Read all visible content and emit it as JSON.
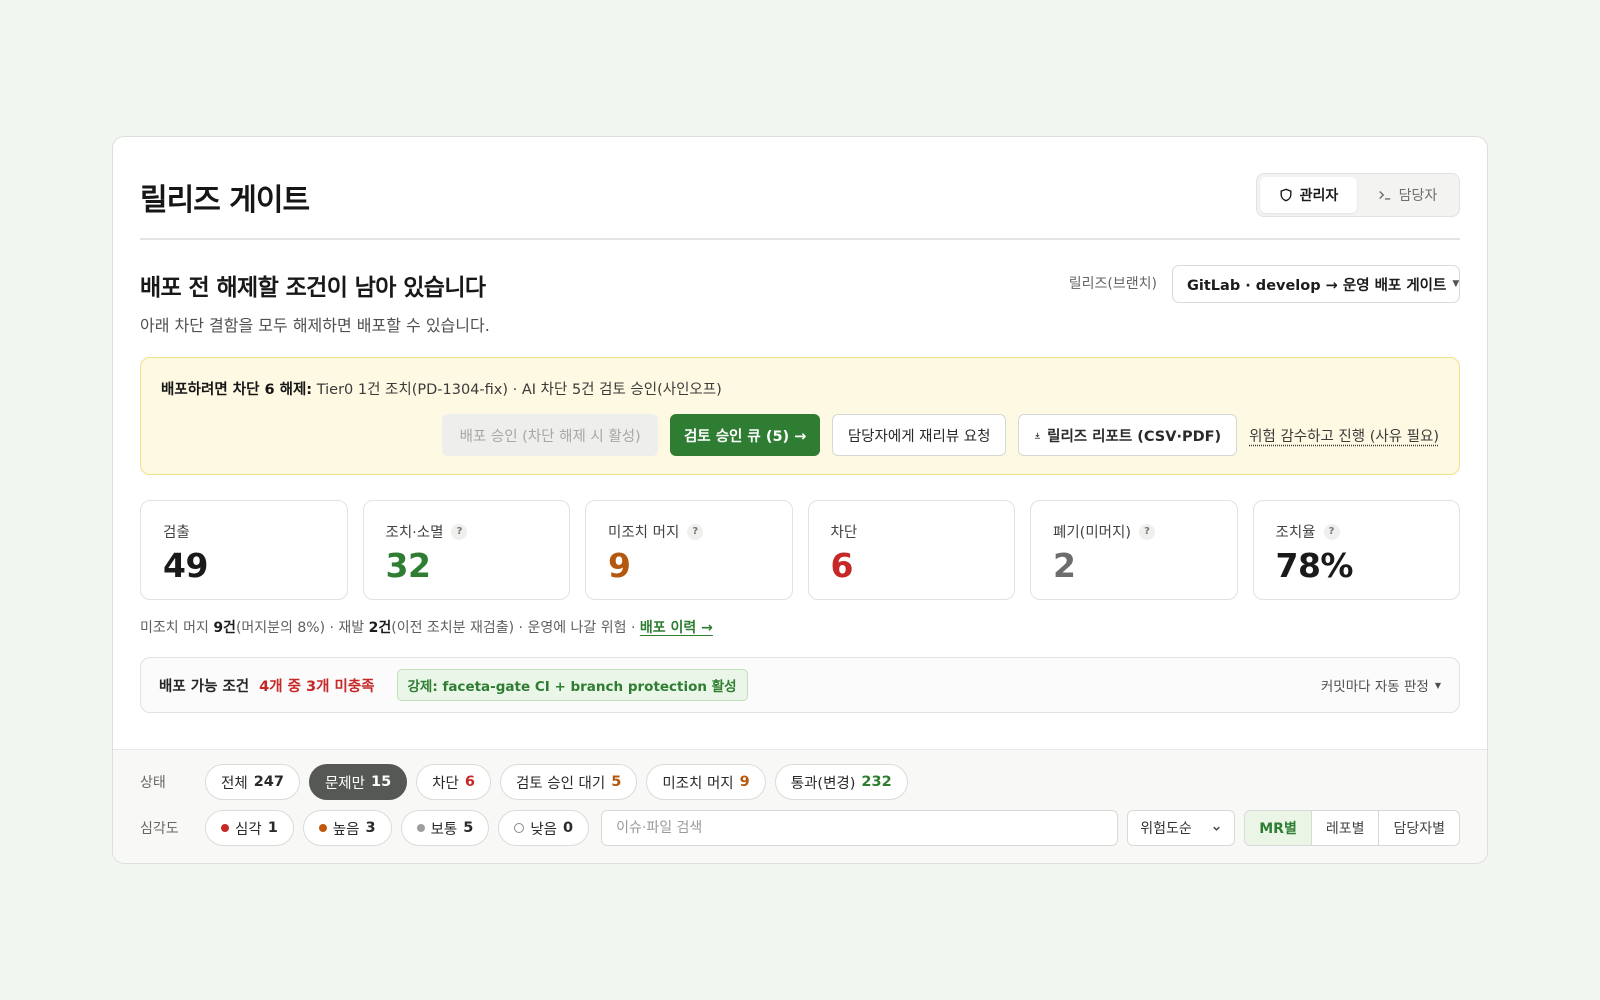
{
  "header": {
    "title": "릴리즈 게이트",
    "roles": [
      {
        "label": "관리자",
        "icon": "shield-icon",
        "active": true
      },
      {
        "label": "담당자",
        "icon": "terminal-icon",
        "active": false
      }
    ]
  },
  "summary": {
    "headline": "배포 전 해제할 조건이 남아 있습니다",
    "subline": "아래 차단 결함을 모두 해제하면 배포할 수 있습니다.",
    "release_label": "릴리즈(브랜치)",
    "release_value": "GitLab · develop → 운영 배포 게이트"
  },
  "banner": {
    "lead": "배포하려면 차단 6 해제:",
    "detail": "Tier0 1건 조치(PD-1304-fix) · AI 차단 5건 검토 승인(사인오프)",
    "actions": {
      "approve": "배포 승인 (차단 해제 시 활성)",
      "review_queue": "검토 승인 큐 (5) →",
      "rereview": "담당자에게 재리뷰 요청",
      "report": "릴리즈 리포트 (CSV·PDF)",
      "accept_risk": "위험 감수하고 진행 (사유 필요)"
    }
  },
  "stats": [
    {
      "label": "검출",
      "value": "49",
      "help": false,
      "color": "#1a1a1a"
    },
    {
      "label": "조치·소멸",
      "value": "32",
      "help": true,
      "color": "#2e7d32"
    },
    {
      "label": "미조치 머지",
      "value": "9",
      "help": true,
      "color": "#b4580f"
    },
    {
      "label": "차단",
      "value": "6",
      "help": false,
      "color": "#c62828"
    },
    {
      "label": "폐기(미머지)",
      "value": "2",
      "help": true,
      "color": "#6d6d6d"
    },
    {
      "label": "조치율",
      "value": "78%",
      "help": true,
      "color": "#1a1a1a"
    }
  ],
  "note": {
    "p1": "미조치 머지 ",
    "b1": "9건",
    "p2": "(머지분의 8%) · 재발 ",
    "b2": "2건",
    "p3": "(이전 조치분 재검출) · 운영에 나갈 위험 · ",
    "link": "배포 이력 →"
  },
  "conditions": {
    "label": "배포 가능 조건",
    "status": "4개 중 3개 미충족",
    "enforce": "강제: faceta-gate CI + branch protection 활성",
    "mode": "커밋마다 자동 판정"
  },
  "filters": {
    "status_label": "상태",
    "status_chips": [
      {
        "label": "전체",
        "count": "247",
        "color": "#2a2a2a",
        "active": false
      },
      {
        "label": "문제만",
        "count": "15",
        "color": "#ffffff",
        "active": true
      },
      {
        "label": "차단",
        "count": "6",
        "color": "#c62828",
        "active": false
      },
      {
        "label": "검토 승인 대기",
        "count": "5",
        "color": "#b4580f",
        "active": false
      },
      {
        "label": "미조치 머지",
        "count": "9",
        "color": "#b4580f",
        "active": false
      },
      {
        "label": "통과(변경)",
        "count": "232",
        "color": "#2e7d32",
        "active": false
      }
    ],
    "severity_label": "심각도",
    "severity_chips": [
      {
        "label": "심각",
        "count": "1",
        "dot": "#c62828",
        "hollow": false
      },
      {
        "label": "높음",
        "count": "3",
        "dot": "#c0590f",
        "hollow": false
      },
      {
        "label": "보통",
        "count": "5",
        "dot": "#9e9e9e",
        "hollow": false
      },
      {
        "label": "낮음",
        "count": "0",
        "dot": "#ffffff",
        "hollow": true
      }
    ],
    "search_placeholder": "이슈·파일 검색",
    "sort_value": "위험도순",
    "group_tabs": [
      {
        "label": "MR별",
        "active": true
      },
      {
        "label": "레포별",
        "active": false
      },
      {
        "label": "담당자별",
        "active": false
      }
    ]
  }
}
